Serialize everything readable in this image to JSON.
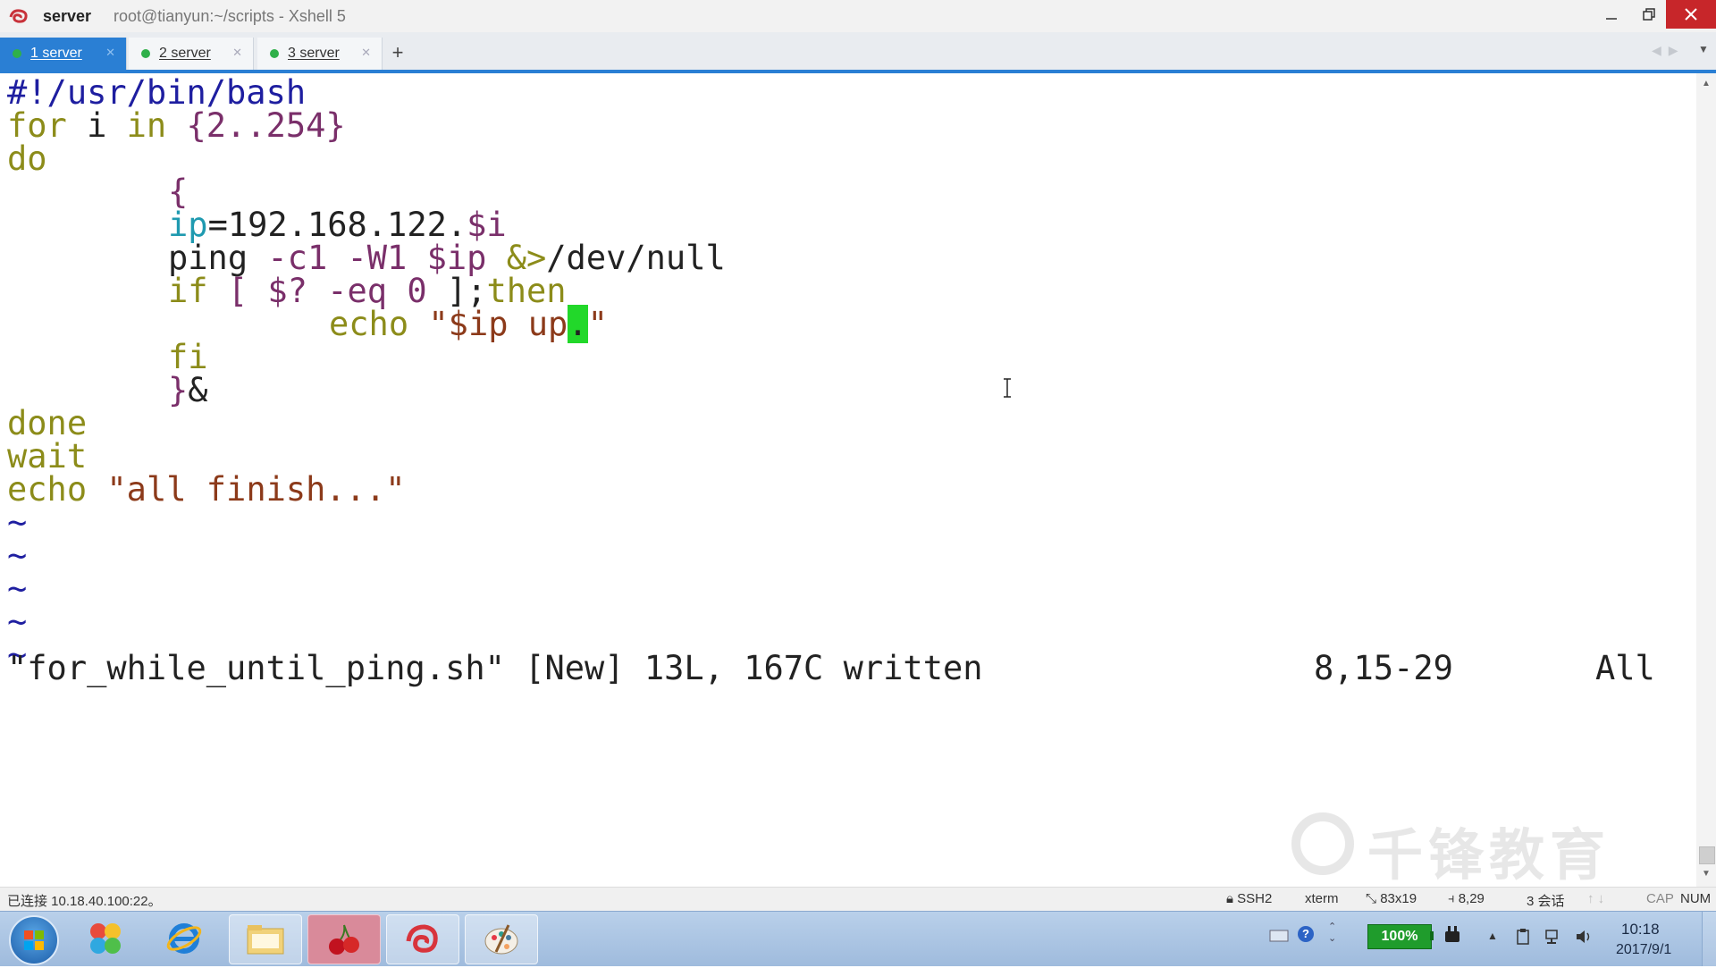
{
  "window": {
    "app_name": "server",
    "title": "root@tianyun:~/scripts - Xshell 5"
  },
  "tabs": [
    {
      "label": "1 server",
      "active": true
    },
    {
      "label": "2 server",
      "active": false
    },
    {
      "label": "3 server",
      "active": false
    }
  ],
  "new_tab_label": "+",
  "editor": {
    "lines": {
      "l1": "#!/usr/bin/bash",
      "l2_kw1": "for",
      "l2_mid": " i ",
      "l2_kw2": "in",
      "l2_rest": " {2..254}",
      "l3": "do",
      "l4": "{",
      "l5_var": "ip",
      "l5_rest": "=192.168.122.",
      "l5_var2": "$i",
      "l6_cmd": "ping ",
      "l6_opts": "-c1 -W1 ",
      "l6_var": "$ip ",
      "l6_op": "&>",
      "l6_rest": "/dev/null",
      "l7_if": "if",
      "l7_test": " [ $? -eq ",
      "l7_zero": "0",
      "l7_end": " ];",
      "l7_then": "then",
      "l8_echo": "echo ",
      "l8_str": "\"$ip up",
      "l8_cursor": ".",
      "l8_close": "\"",
      "l9": "fi",
      "l10_br": "}",
      "l10_amp": "&",
      "l11": "done",
      "l12": "wait",
      "l13_echo": "echo ",
      "l13_str": "\"all finish...\"",
      "tilde": "~"
    },
    "message": "\"for_while_until_ping.sh\" [New] 13L, 167C written",
    "cursor_position": "8,15-29",
    "scroll_position": "All"
  },
  "watermark": "千锋教育",
  "statusbar": {
    "connection": "已连接 10.18.40.100:22。",
    "protocol": "SSH2",
    "terminal_type": "xterm",
    "size": "83x19",
    "position": "8,29",
    "sessions": "3 会话",
    "cap": "CAP",
    "num": "NUM"
  },
  "taskbar": {
    "battery": "100%",
    "time": "10:18",
    "date": "2017/9/1"
  },
  "colors": {
    "accent": "#2a7fd4",
    "cursor": "#22d82a",
    "close": "#c7262a"
  }
}
